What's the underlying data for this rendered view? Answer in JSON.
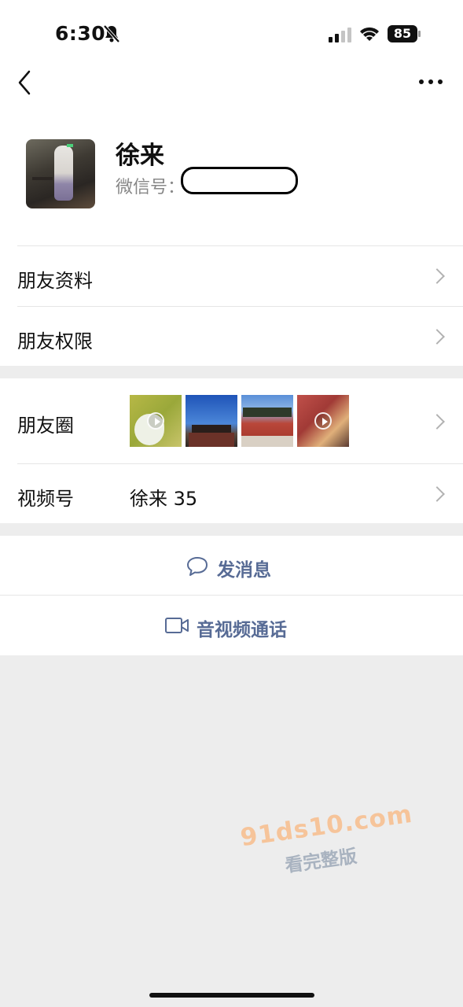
{
  "status_bar": {
    "time": "6:30",
    "battery": "85",
    "icons": [
      "bell-slash-icon",
      "cellular-signal-icon",
      "wifi-icon",
      "battery-icon"
    ]
  },
  "nav": {
    "back_icon": "chevron-left-icon",
    "more_icon": "more-dots-icon"
  },
  "profile": {
    "nickname": "徐来",
    "wechat_id_label": "微信号："
  },
  "menu": {
    "profile_info": "朋友资料",
    "permissions": "朋友权限",
    "moments": "朋友圈",
    "channels": "视频号",
    "channels_value": "徐来 35"
  },
  "actions": {
    "message": "发消息",
    "call": "音视频通话"
  },
  "watermark": {
    "line1": "91ds10.com",
    "line2": "看完整版"
  },
  "colors": {
    "link": "#576b95",
    "background": "#ededed",
    "divider": "#e5e5e5",
    "chevron": "#b2b2b2"
  }
}
